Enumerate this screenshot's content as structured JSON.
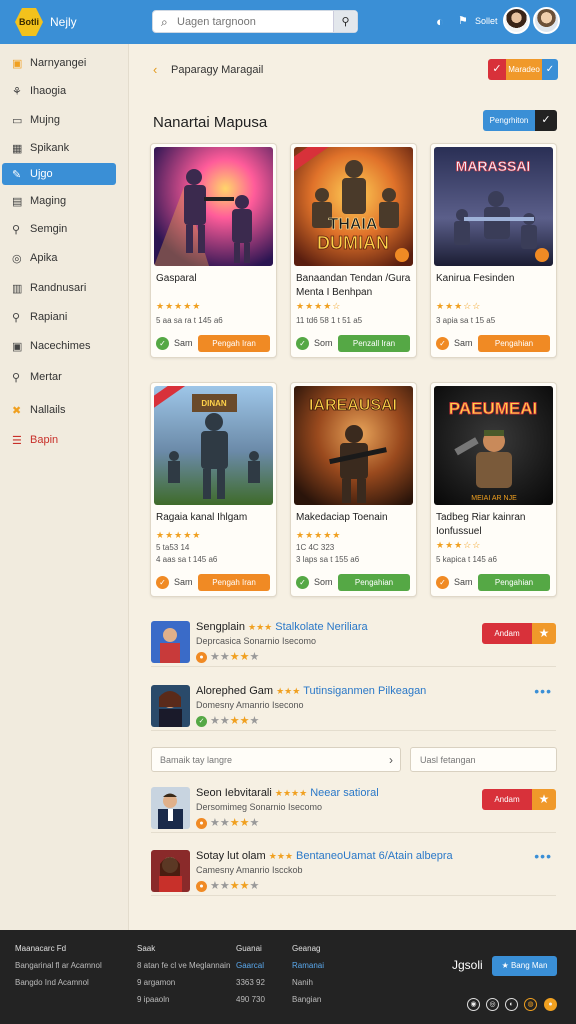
{
  "header": {
    "logo_text": "Botli",
    "app_name": "Nejly",
    "search_placeholder": "Uagen targnoon",
    "user_label": "Sollet",
    "icons": [
      "settings-icon",
      "notification-icon"
    ]
  },
  "sidebar": {
    "items": [
      {
        "label": "Narnyangei",
        "icon": "app-icon"
      },
      {
        "label": "Ihaogia",
        "icon": "tree-icon"
      },
      {
        "label": "Mujng",
        "icon": "folder-icon"
      },
      {
        "label": "Spikank",
        "icon": "grid-icon"
      },
      {
        "label": "Ujgo",
        "icon": "edit-icon",
        "active": true
      },
      {
        "label": "Maging",
        "icon": "doc-icon"
      },
      {
        "label": "Semgin",
        "icon": "search-icon"
      },
      {
        "label": "Apika",
        "icon": "globe-icon"
      },
      {
        "label": "Randnusari",
        "icon": "list-icon"
      },
      {
        "label": "Rapiani",
        "icon": "search-icon"
      },
      {
        "label": "Nacechimes",
        "icon": "box-icon"
      },
      {
        "label": "Mertar",
        "icon": "search-icon"
      },
      {
        "label": "Nallails",
        "icon": "tools-icon"
      },
      {
        "label": "Bapin",
        "icon": "menu-icon"
      }
    ]
  },
  "main": {
    "breadcrumb": "Paparagy Maragail",
    "top_button": "Maradeo",
    "section_title": "Nanartai Mapusa",
    "section_button": "Pengrhiton",
    "cards": [
      {
        "title": "Gasparal",
        "rating": "★★★★★",
        "meta1": "5 aa sa ra t 145 a6",
        "meta2": "",
        "status": "Sam",
        "button": "Pengah Iran",
        "btn_color": "orange",
        "chk_color": "green"
      },
      {
        "title": "Banaandan Tendan /Gura Menta I Benhpan",
        "rating": "★★★★☆",
        "meta1": "11 td6 58 1 t 51 a5",
        "meta2": "",
        "status": "Som",
        "button": "Penzall Iran",
        "btn_color": "green",
        "chk_color": "green"
      },
      {
        "title": "Kanirua Fesinden",
        "rating": "★★★☆☆",
        "meta1": "3 apia sa t 15 a5",
        "meta2": "",
        "status": "Sam",
        "button": "Pengahian",
        "btn_color": "orange",
        "chk_color": "orange"
      },
      {
        "title": "Ragaia kanal Ihlgam",
        "rating": "★★★★★",
        "meta1": "5 ta53 14",
        "meta2": "4 aas sa t 145 a6",
        "status": "Sam",
        "button": "Pengah Iran",
        "btn_color": "orange",
        "chk_color": "orange"
      },
      {
        "title": "Makedaciap Toenain",
        "rating": "★★★★★",
        "meta1": "1C 4C 323",
        "meta2": "3 laps sa t 155 a6",
        "status": "Som",
        "button": "Pengahian",
        "btn_color": "green",
        "chk_color": "green"
      },
      {
        "title": "Tadbeg Riar kainran Ionfussuel",
        "rating": "★★★☆☆",
        "meta1": "5 kapica t 145 a6",
        "meta2": "",
        "status": "Sam",
        "button": "Pengahian",
        "btn_color": "green",
        "chk_color": "orange"
      }
    ],
    "list": [
      {
        "name": "Sengplain",
        "stars": "★★★",
        "highlight": "Stalkolate Neriliara",
        "sub": "Deprcasica Sonarnio Isecomo",
        "button": "Andam",
        "type": "button",
        "dot_color": "orange"
      },
      {
        "name": "Alorephed Gam",
        "stars": "★★★",
        "highlight": "Tutinsiganmen Pilkeagan",
        "sub": "Domesny Amanrio Isecono",
        "type": "more",
        "dot_color": "green"
      },
      {
        "name": "Seon Iebvitarali",
        "stars": "★★★★",
        "highlight": "Neear satioral",
        "sub": "Dersomimeg Sonarnio Isecomo",
        "button": "Andam",
        "type": "button",
        "dot_color": "orange"
      },
      {
        "name": "Sotay lut olam",
        "stars": "★★★",
        "highlight": "BentaneoUamat 6/Atain albepra",
        "sub": "Camesny Amanrio Iscckob",
        "type": "more",
        "dot_color": "orange"
      }
    ],
    "field1_placeholder": "Bamaik tay langre",
    "field2_placeholder": "Uasl fetangan"
  },
  "footer": {
    "col1": [
      "Maanacarc Fd",
      "Bangarinal fl ar Acamnol",
      "Bangdo Ind Acamnol"
    ],
    "col2": [
      "Saak",
      "8 atan fe cl ve Meglannain",
      "9 argamon",
      "9 ipaaoln"
    ],
    "col3": [
      "Guanai",
      "Gaarcal",
      "3363 92",
      "490 730"
    ],
    "col4": [
      "Geanag",
      "Ramanai",
      "Nanih",
      "Bangian"
    ],
    "brand": "Jgsoli",
    "button": "Bang Man"
  }
}
